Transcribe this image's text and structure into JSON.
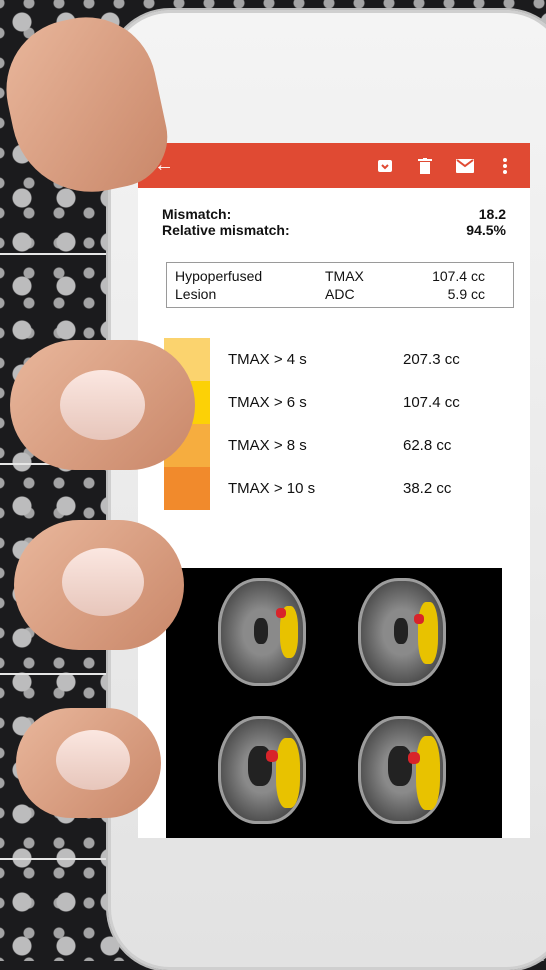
{
  "toolbar": {
    "accent_color": "#e04a33",
    "icons": [
      "back-arrow-icon",
      "archive-icon",
      "trash-icon",
      "mail-icon",
      "more-vert-icon"
    ]
  },
  "summary": {
    "mismatch_label": "Mismatch:",
    "mismatch_value": "18.2",
    "relative_label": "Relative mismatch:",
    "relative_value": "94.5%"
  },
  "lesion_table": {
    "rows": [
      {
        "label": "Hypoperfused",
        "metric": "TMAX",
        "value": "107.4 cc"
      },
      {
        "label": "Lesion",
        "metric": "ADC",
        "value": "5.9 cc"
      }
    ]
  },
  "tmax_table": {
    "rows": [
      {
        "label": "TMAX > 4 s",
        "value": "207.3 cc",
        "color": "#fbd36e"
      },
      {
        "label": "TMAX > 6 s",
        "value": "107.4 cc",
        "color": "#fcd106"
      },
      {
        "label": "TMAX > 8 s",
        "value": "62.8 cc",
        "color": "#f6ad3f"
      },
      {
        "label": "TMAX > 10 s",
        "value": "38.2 cc",
        "color": "#f18a2c"
      }
    ]
  }
}
